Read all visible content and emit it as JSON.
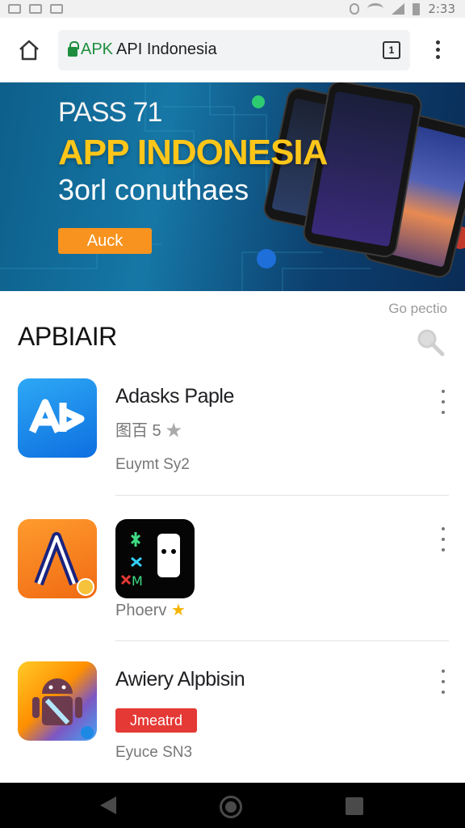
{
  "status_bar": {
    "time": "2:33"
  },
  "toolbar": {
    "url_prefix": "APK",
    "url_rest": "API Indonesia",
    "tab_count": "1"
  },
  "banner": {
    "small_text": "PASS 71",
    "title": "APP INDONESIA",
    "subtitle": "3orl conuthaes",
    "button_label": "Auck"
  },
  "section": {
    "note": "Go pectio",
    "title": "APBIAIR"
  },
  "apps": [
    {
      "name": "Adasks Paple",
      "meta": "图百 5",
      "developer": "Euymt Sy2"
    },
    {
      "name": "",
      "meta": "Phoerv",
      "developer": ""
    },
    {
      "name": "Awiery Alpbisin",
      "tag": "Jmeatrd",
      "developer": "Eyuce SN3"
    }
  ],
  "colors": {
    "accent": "#1e8e3e",
    "banner_title": "#ffc61a",
    "banner_button": "#f7931e",
    "tag": "#e53935"
  }
}
